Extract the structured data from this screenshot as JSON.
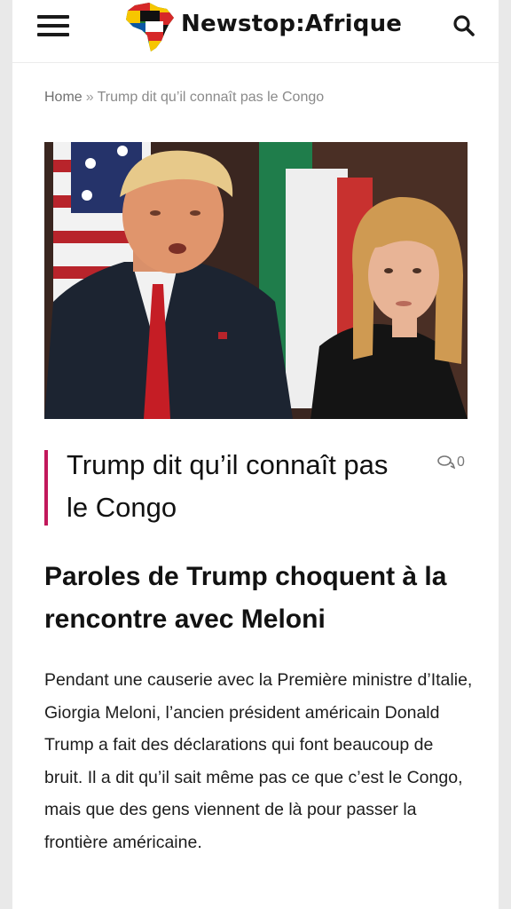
{
  "header": {
    "logo_text": "Newstop:Afrique",
    "menu_icon": "hamburger-icon",
    "search_icon": "search-icon"
  },
  "breadcrumb": {
    "home": "Home",
    "separator": "»",
    "current": "Trump dit qu’il connaît pas le Congo"
  },
  "article": {
    "title": "Trump dit qu’il connaît pas le Congo",
    "comment_count": "0",
    "comment_icon": "comments-icon",
    "accent_color": "#c2185b",
    "subheading": "Paroles de Trump choquent à la rencontre avec Meloni",
    "body": "Pendant une causerie avec la Première ministre d’Italie, Giorgia Meloni, l’ancien président américain Donald Trump a fait des déclarations qui font beaucoup de bruit. Il a dit qu’il sait même pas ce que c’est le Congo, mais que des gens viennent de là pour passer la frontière américaine."
  }
}
